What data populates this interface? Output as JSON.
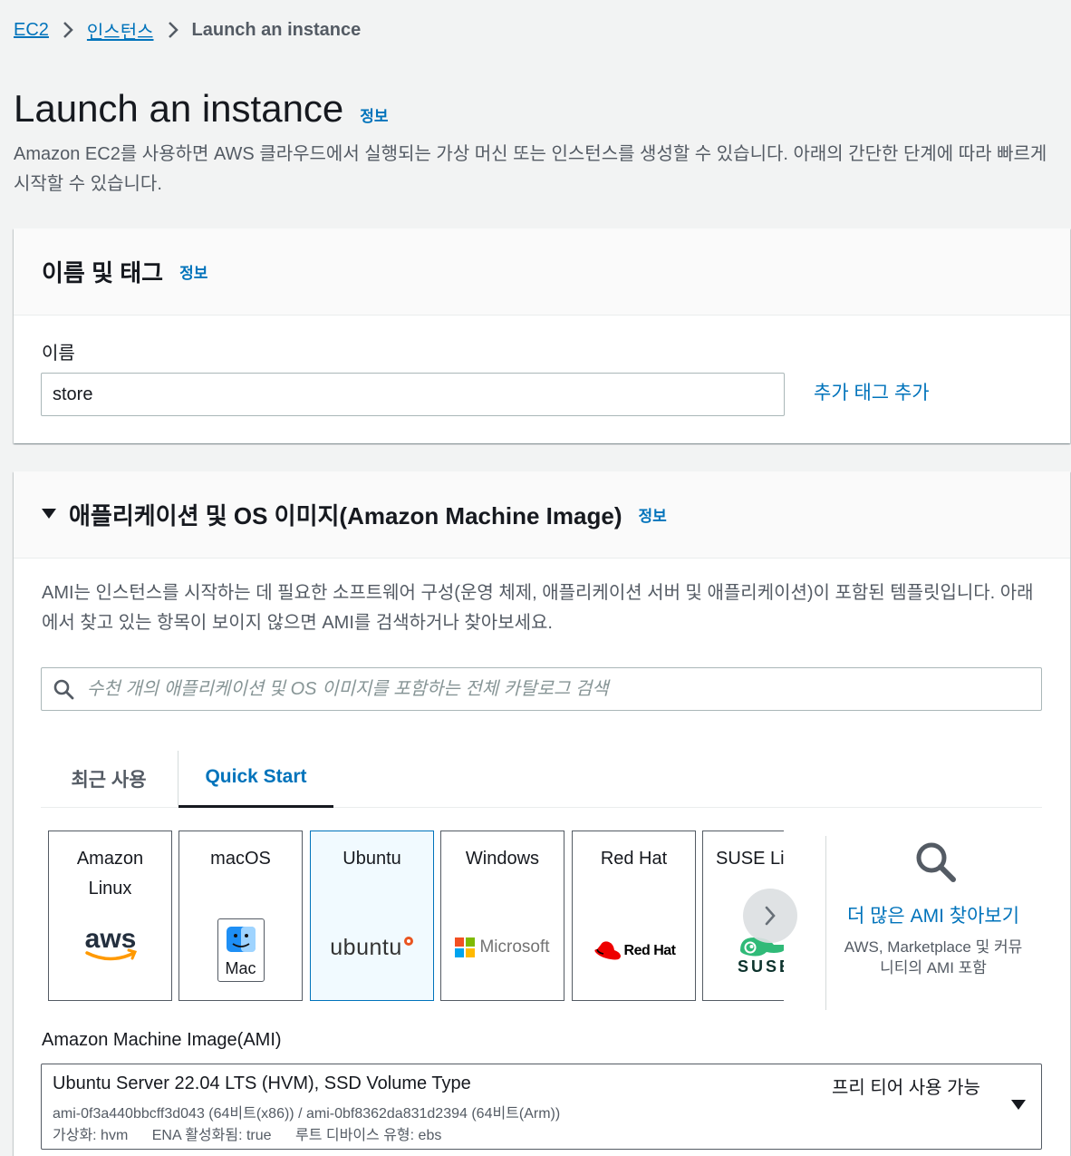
{
  "breadcrumb": {
    "ec2": "EC2",
    "instances": "인스턴스",
    "current": "Launch an instance"
  },
  "page": {
    "title": "Launch an instance",
    "info": "정보",
    "description": "Amazon EC2를 사용하면 AWS 클라우드에서 실행되는 가상 머신 또는 인스턴스를 생성할 수 있습니다. 아래의 간단한 단계에 따라 빠르게 시작할 수 있습니다."
  },
  "name_tags": {
    "title": "이름 및 태그",
    "info": "정보",
    "name_label": "이름",
    "name_value": "store",
    "add_tags": "추가 태그 추가"
  },
  "ami_section": {
    "title": "애플리케이션 및 OS 이미지(Amazon Machine Image)",
    "info": "정보",
    "description": "AMI는 인스턴스를 시작하는 데 필요한 소프트웨어 구성(운영 체제, 애플리케이션 서버 및 애플리케이션)이 포함된 템플릿입니다. 아래에서 찾고 있는 항목이 보이지 않으면 AMI를 검색하거나 찾아보세요.",
    "search_placeholder": "수천 개의 애플리케이션 및 OS 이미지를 포함하는 전체 카탈로그 검색",
    "tabs": [
      "최근 사용",
      "Quick Start"
    ],
    "active_tab": "Quick Start",
    "os_options": [
      {
        "name": "Amazon\nLinux",
        "logo_text": "aws"
      },
      {
        "name": "macOS",
        "logo_text": "Mac"
      },
      {
        "name": "Ubuntu",
        "logo_text": "ubuntu"
      },
      {
        "name": "Windows",
        "logo_text": "Microsoft"
      },
      {
        "name": "Red Hat",
        "logo_text": "Red Hat"
      },
      {
        "name": "SUSE Linux",
        "logo_text": "SUSE"
      }
    ],
    "selected_os": "Ubuntu",
    "more_amis_title": "더 많은 AMI 찾아보기",
    "more_amis_sub": "AWS, Marketplace 및 커뮤니티의 AMI 포함",
    "ami_label": "Amazon Machine Image(AMI)",
    "selected_ami": {
      "name": "Ubuntu Server 22.04 LTS (HVM), SSD Volume Type",
      "ids": "ami-0f3a440bbcff3d043 (64비트(x86)) / ami-0bf8362da831d2394 (64비트(Arm))",
      "virtualization": "가상화: hvm",
      "ena": "ENA 활성화됨: true",
      "root_device": "루트 디바이스 유형: ebs",
      "badge": "프리 티어 사용 가능"
    }
  },
  "colors": {
    "link": "#0073bb",
    "background": "#f2f3f3",
    "selected_card": "#f1faff",
    "ubuntu_orange": "#e95420",
    "redhat_red": "#ee0000",
    "suse_green": "#30ba78",
    "aws_orange": "#ff9900"
  }
}
